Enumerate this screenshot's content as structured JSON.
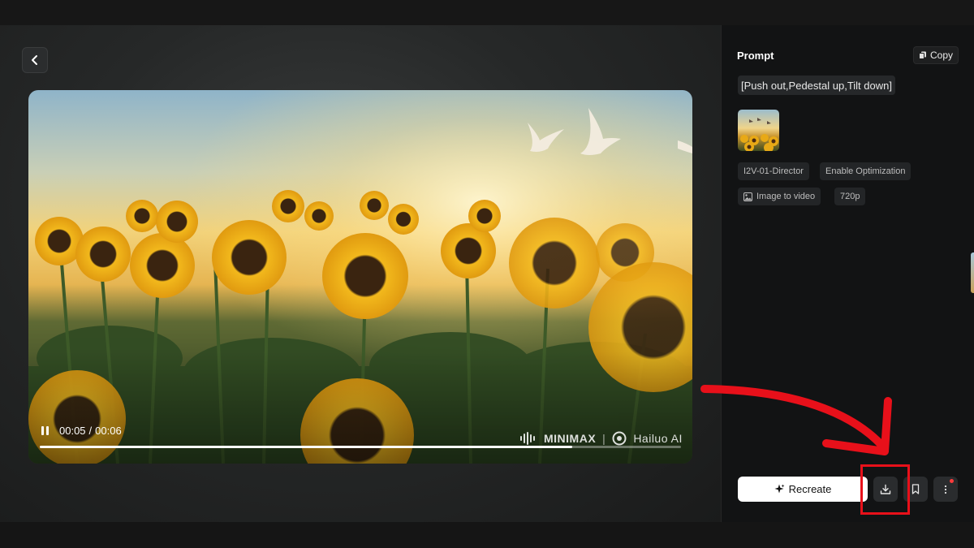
{
  "app": {
    "back_label": "Back"
  },
  "player": {
    "current_time": "00:05",
    "separator": "/",
    "duration": "00:06",
    "progress": 0.83,
    "watermark_left": "MINIMAX",
    "watermark_divider": "|",
    "watermark_right": "Hailuo AI"
  },
  "panel": {
    "title": "Prompt",
    "copy_label": "Copy",
    "prompt_text": "[Push out,Pedestal up,Tilt down]",
    "tags": {
      "model": "I2V-01-Director",
      "optimization": "Enable Optimization",
      "type": "Image to video",
      "resolution": "720p"
    }
  },
  "actions": {
    "recreate_label": "Recreate",
    "download_icon": "download-icon",
    "bookmark_icon": "bookmark-icon",
    "more_icon": "more-vertical-icon",
    "notification_dot": true
  },
  "colors": {
    "annotation": "#e8101a",
    "background": "#141414",
    "panel": "#121314"
  }
}
